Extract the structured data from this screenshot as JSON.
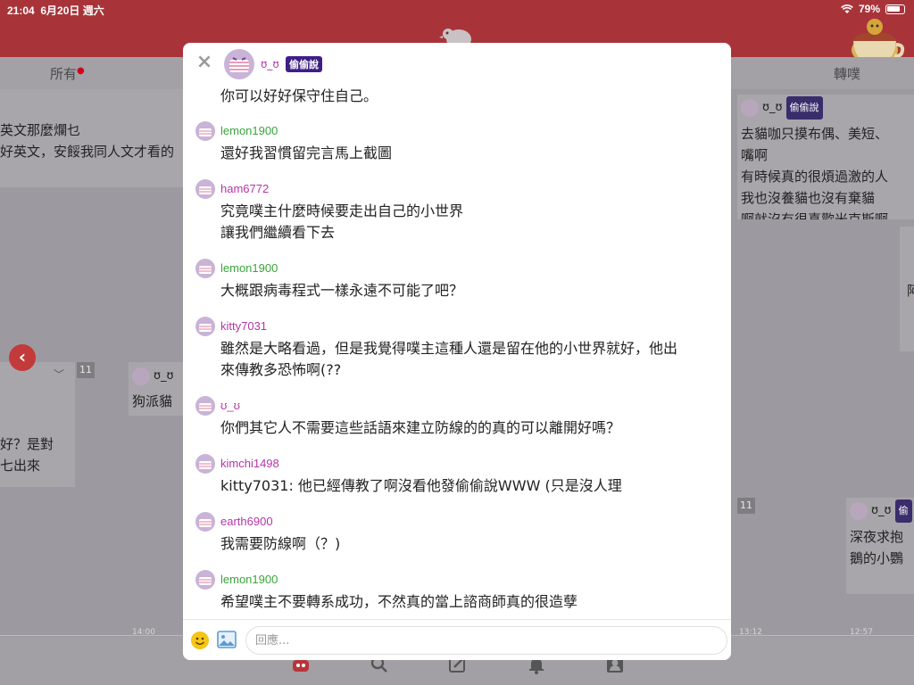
{
  "statusbar": {
    "time": "21:04",
    "date": "6月20日 週六",
    "battery": "79%"
  },
  "tabs": {
    "all": "所有",
    "replurks": "轉噗"
  },
  "background": {
    "card_left_top": [
      "英文那麼爛乜",
      "好英文，安餒我同人文才看的"
    ],
    "card_left_mid": [
      "好？是對",
      "七出來"
    ],
    "card_mid": {
      "name": "ʊ_ʊ",
      "text": "狗派貓"
    },
    "card_right_top": {
      "name": "ʊ_ʊ",
      "badge": "偷偷說",
      "lines": [
        "去貓咖只摸布偶、美短、",
        "嘴啊",
        "有時候真的很煩過激的人",
        "我也沒養貓也沒有棄貓",
        "啊就沒有很喜歡米克斯啊"
      ]
    },
    "card_right_bottom": {
      "name": "ʊ_ʊ",
      "badge": "偷",
      "lines": [
        "深夜求抱",
        "鵝的小鸚"
      ]
    },
    "card_edge": "阿",
    "counters": [
      "11",
      "11"
    ],
    "times": [
      "14:00",
      "13:12",
      "12:57"
    ]
  },
  "modal": {
    "op": {
      "name": "ʊ_ʊ",
      "badge": "偷偷說",
      "text": "你可以好好保守住自己。"
    },
    "responses": [
      {
        "name": "lemon1900",
        "color": "green",
        "lines": [
          "還好我習慣留完言馬上截圖"
        ]
      },
      {
        "name": "ham6772",
        "color": "purple",
        "lines": [
          "究竟噗主什麼時候要走出自己的小世界",
          "讓我們繼續看下去"
        ]
      },
      {
        "name": "lemon1900",
        "color": "green",
        "lines": [
          "大概跟病毒程式一樣永遠不可能了吧？"
        ]
      },
      {
        "name": "kitty7031",
        "color": "purple",
        "lines": [
          "雖然是大略看過，但是我覺得噗主這種人還是留在他的小世界就好，他出",
          "來傳教多恐怖啊(??"
        ]
      },
      {
        "name": "ʊ_ʊ",
        "color": "purple",
        "lines": [
          "你們其它人不需要這些話語來建立防線的的真的可以離開好嗎？"
        ]
      },
      {
        "name": "kimchi1498",
        "color": "purple",
        "lines": [
          "kitty7031: 他已經傳教了啊沒看他發偷偷說WWW (只是沒人理"
        ]
      },
      {
        "name": "earth6900",
        "color": "purple",
        "lines": [
          "我需要防線啊（？)"
        ]
      },
      {
        "name": "lemon1900",
        "color": "green",
        "lines": [
          "希望噗主不要轉系成功，不然真的當上諮商師真的很造孽"
        ]
      }
    ],
    "reply_placeholder": "回應..."
  }
}
